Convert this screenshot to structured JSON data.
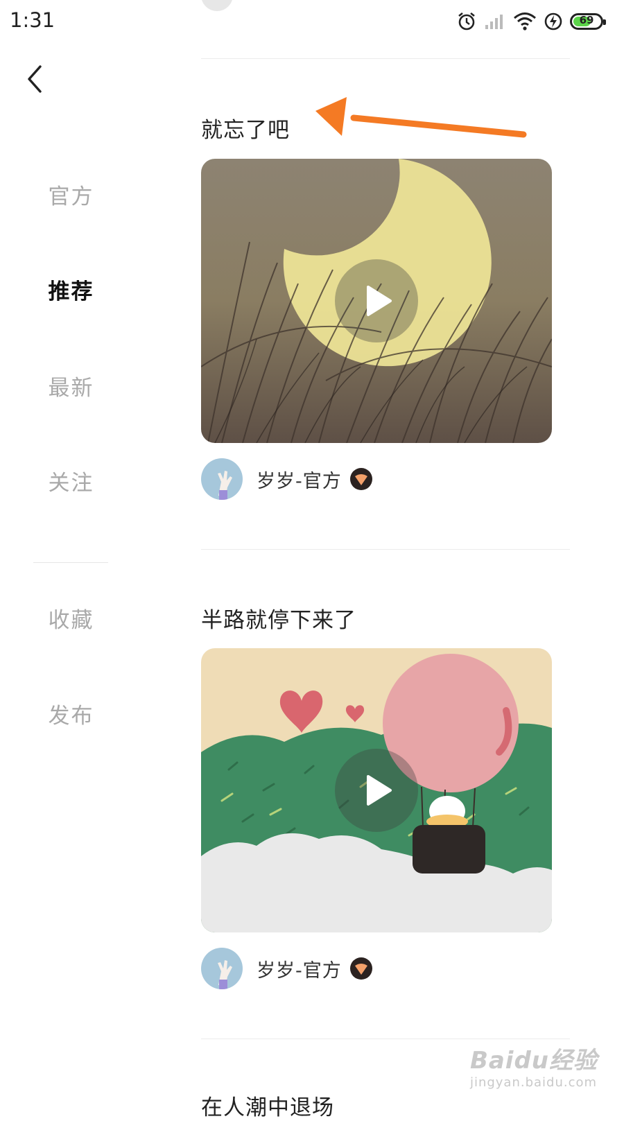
{
  "status_bar": {
    "time": "1:31",
    "battery": "69",
    "battery_level": 0.69
  },
  "sidebar": {
    "items": [
      {
        "label": "官方",
        "active": false
      },
      {
        "label": "推荐",
        "active": true
      },
      {
        "label": "最新",
        "active": false
      },
      {
        "label": "关注",
        "active": false
      },
      {
        "label": "收藏",
        "active": false
      },
      {
        "label": "发布",
        "active": false
      }
    ]
  },
  "posts": [
    {
      "title": "就忘了吧",
      "author": "岁岁-官方"
    },
    {
      "title": "半路就停下来了",
      "author": "岁岁-官方"
    },
    {
      "title": "在人潮中退场"
    }
  ],
  "watermark": {
    "main": "Baidu经验",
    "sub": "jingyan.baidu.com"
  },
  "colors": {
    "annotation_arrow": "#f47a24",
    "active_tab": "#111111",
    "inactive_tab": "#a9a9a9"
  }
}
